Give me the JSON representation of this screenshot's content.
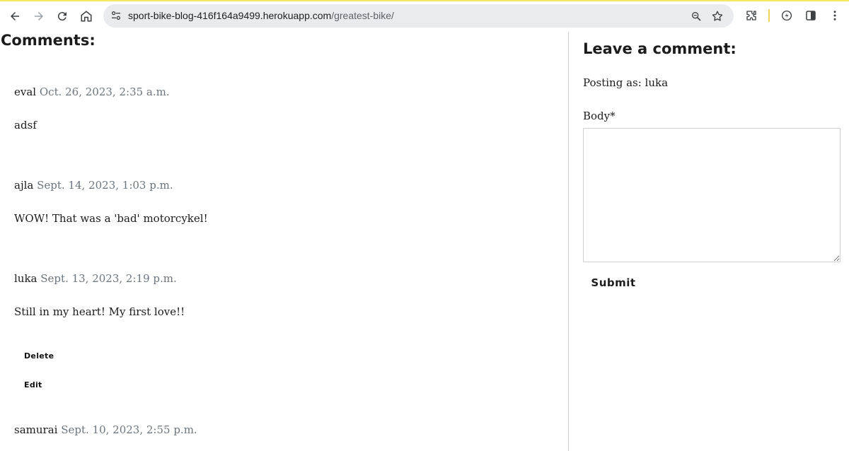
{
  "browser": {
    "url_host": "sport-bike-blog-416f164a9499.herokuapp.com",
    "url_path": "/greatest-bike/",
    "accent": "#f5e663"
  },
  "comments": {
    "title": "Comments:",
    "items": [
      {
        "author": "eval",
        "date": "Oct. 26, 2023, 2:35 a.m.",
        "body": "adsf"
      },
      {
        "author": "ajla",
        "date": "Sept. 14, 2023, 1:03 p.m.",
        "body": "WOW! That was a 'bad' motorcykel!"
      },
      {
        "author": "luka",
        "date": "Sept. 13, 2023, 2:19 p.m.",
        "body": "Still in my heart! My first love!!"
      },
      {
        "author": "samurai",
        "date": "Sept. 10, 2023, 2:55 p.m."
      }
    ],
    "delete_label": "Delete",
    "edit_label": "Edit"
  },
  "form": {
    "title": "Leave a comment:",
    "posting_as": "Posting as: luka",
    "body_label": "Body*",
    "body_value": "",
    "submit_label": "Submit"
  }
}
